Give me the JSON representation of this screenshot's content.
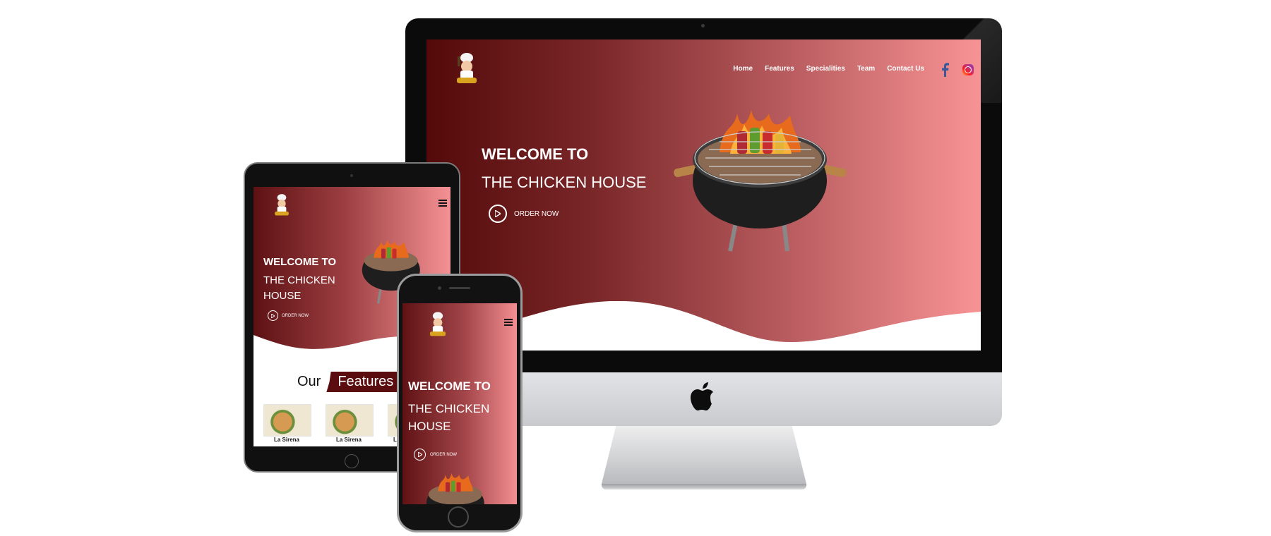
{
  "desktop": {
    "nav": [
      "Home",
      "Features",
      "Specialities",
      "Team",
      "Contact Us"
    ],
    "hero_line1": "WELCOME TO",
    "hero_line2": "THE CHICKEN HOUSE",
    "order_label": "ORDER NOW",
    "social_icons": [
      "facebook-icon",
      "instagram-icon"
    ]
  },
  "tablet": {
    "hero_line1": "WELCOME TO",
    "hero_line2a": "THE CHICKEN",
    "hero_line2b": "HOUSE",
    "order_label": "ORDER NOW",
    "features_prefix": "Our",
    "features_word": "Features",
    "cards": [
      "La Sirena",
      "La Sirena",
      "La"
    ]
  },
  "phone": {
    "hero_line1": "WELCOME TO",
    "hero_line2a": "THE CHICKEN",
    "hero_line2b": "HOUSE",
    "order_label": "ORDER NOW"
  },
  "colors": {
    "gradient_dark": "#540a0a",
    "gradient_light": "#f89395",
    "ribbon": "#5a0c0e"
  }
}
